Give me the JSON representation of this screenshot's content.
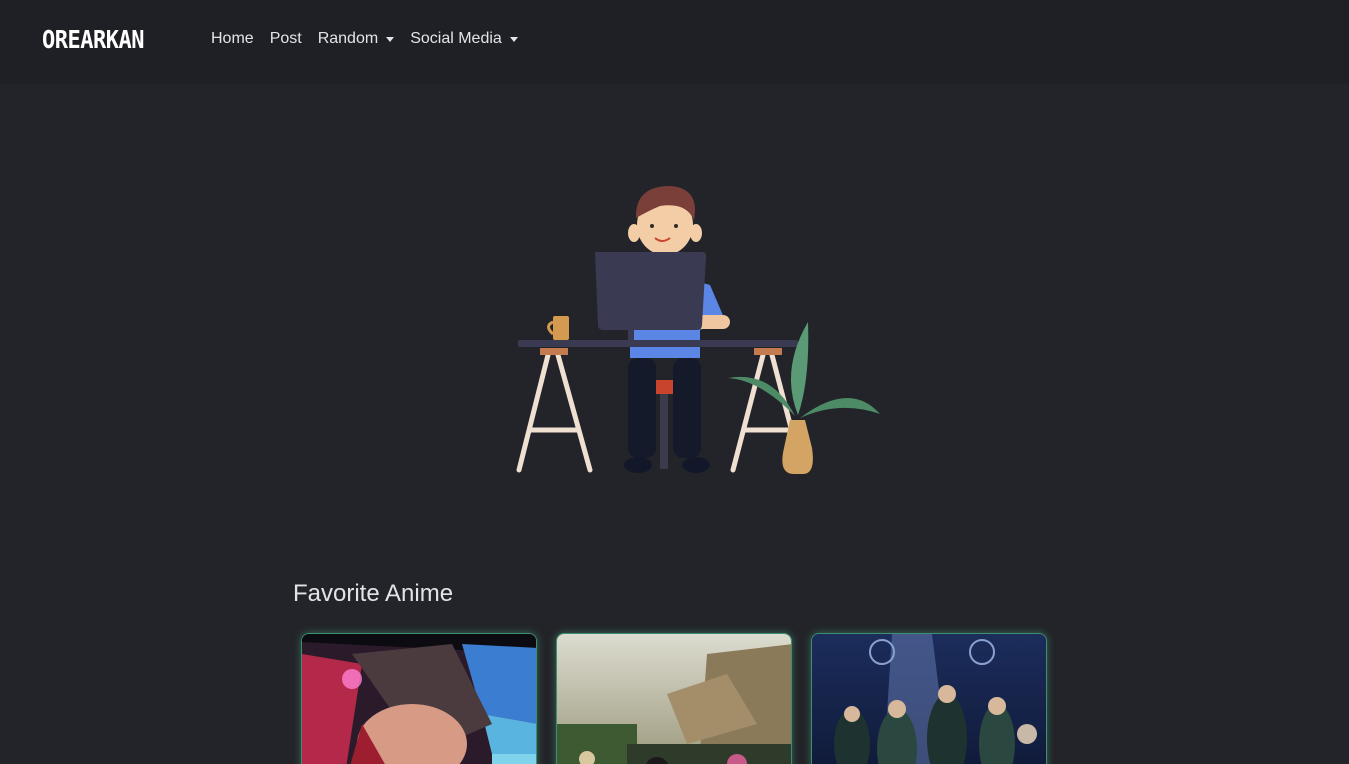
{
  "navbar": {
    "brand": "OREARKAN",
    "links": [
      {
        "label": "Home",
        "dropdown": false
      },
      {
        "label": "Post",
        "dropdown": false
      },
      {
        "label": "Random",
        "dropdown": true
      },
      {
        "label": "Social Media",
        "dropdown": true
      }
    ]
  },
  "hero": {
    "illustration": "person-working-at-desk-illustration"
  },
  "favorites": {
    "title": "Favorite Anime",
    "cards": [
      {
        "image": "anime-poster-1"
      },
      {
        "image": "anime-poster-2"
      },
      {
        "image": "anime-poster-3"
      }
    ]
  },
  "colors": {
    "background": "#232429",
    "navbar": "#1f2025",
    "accent": "#1e6fd9",
    "card_glow": "#3e8f72"
  }
}
